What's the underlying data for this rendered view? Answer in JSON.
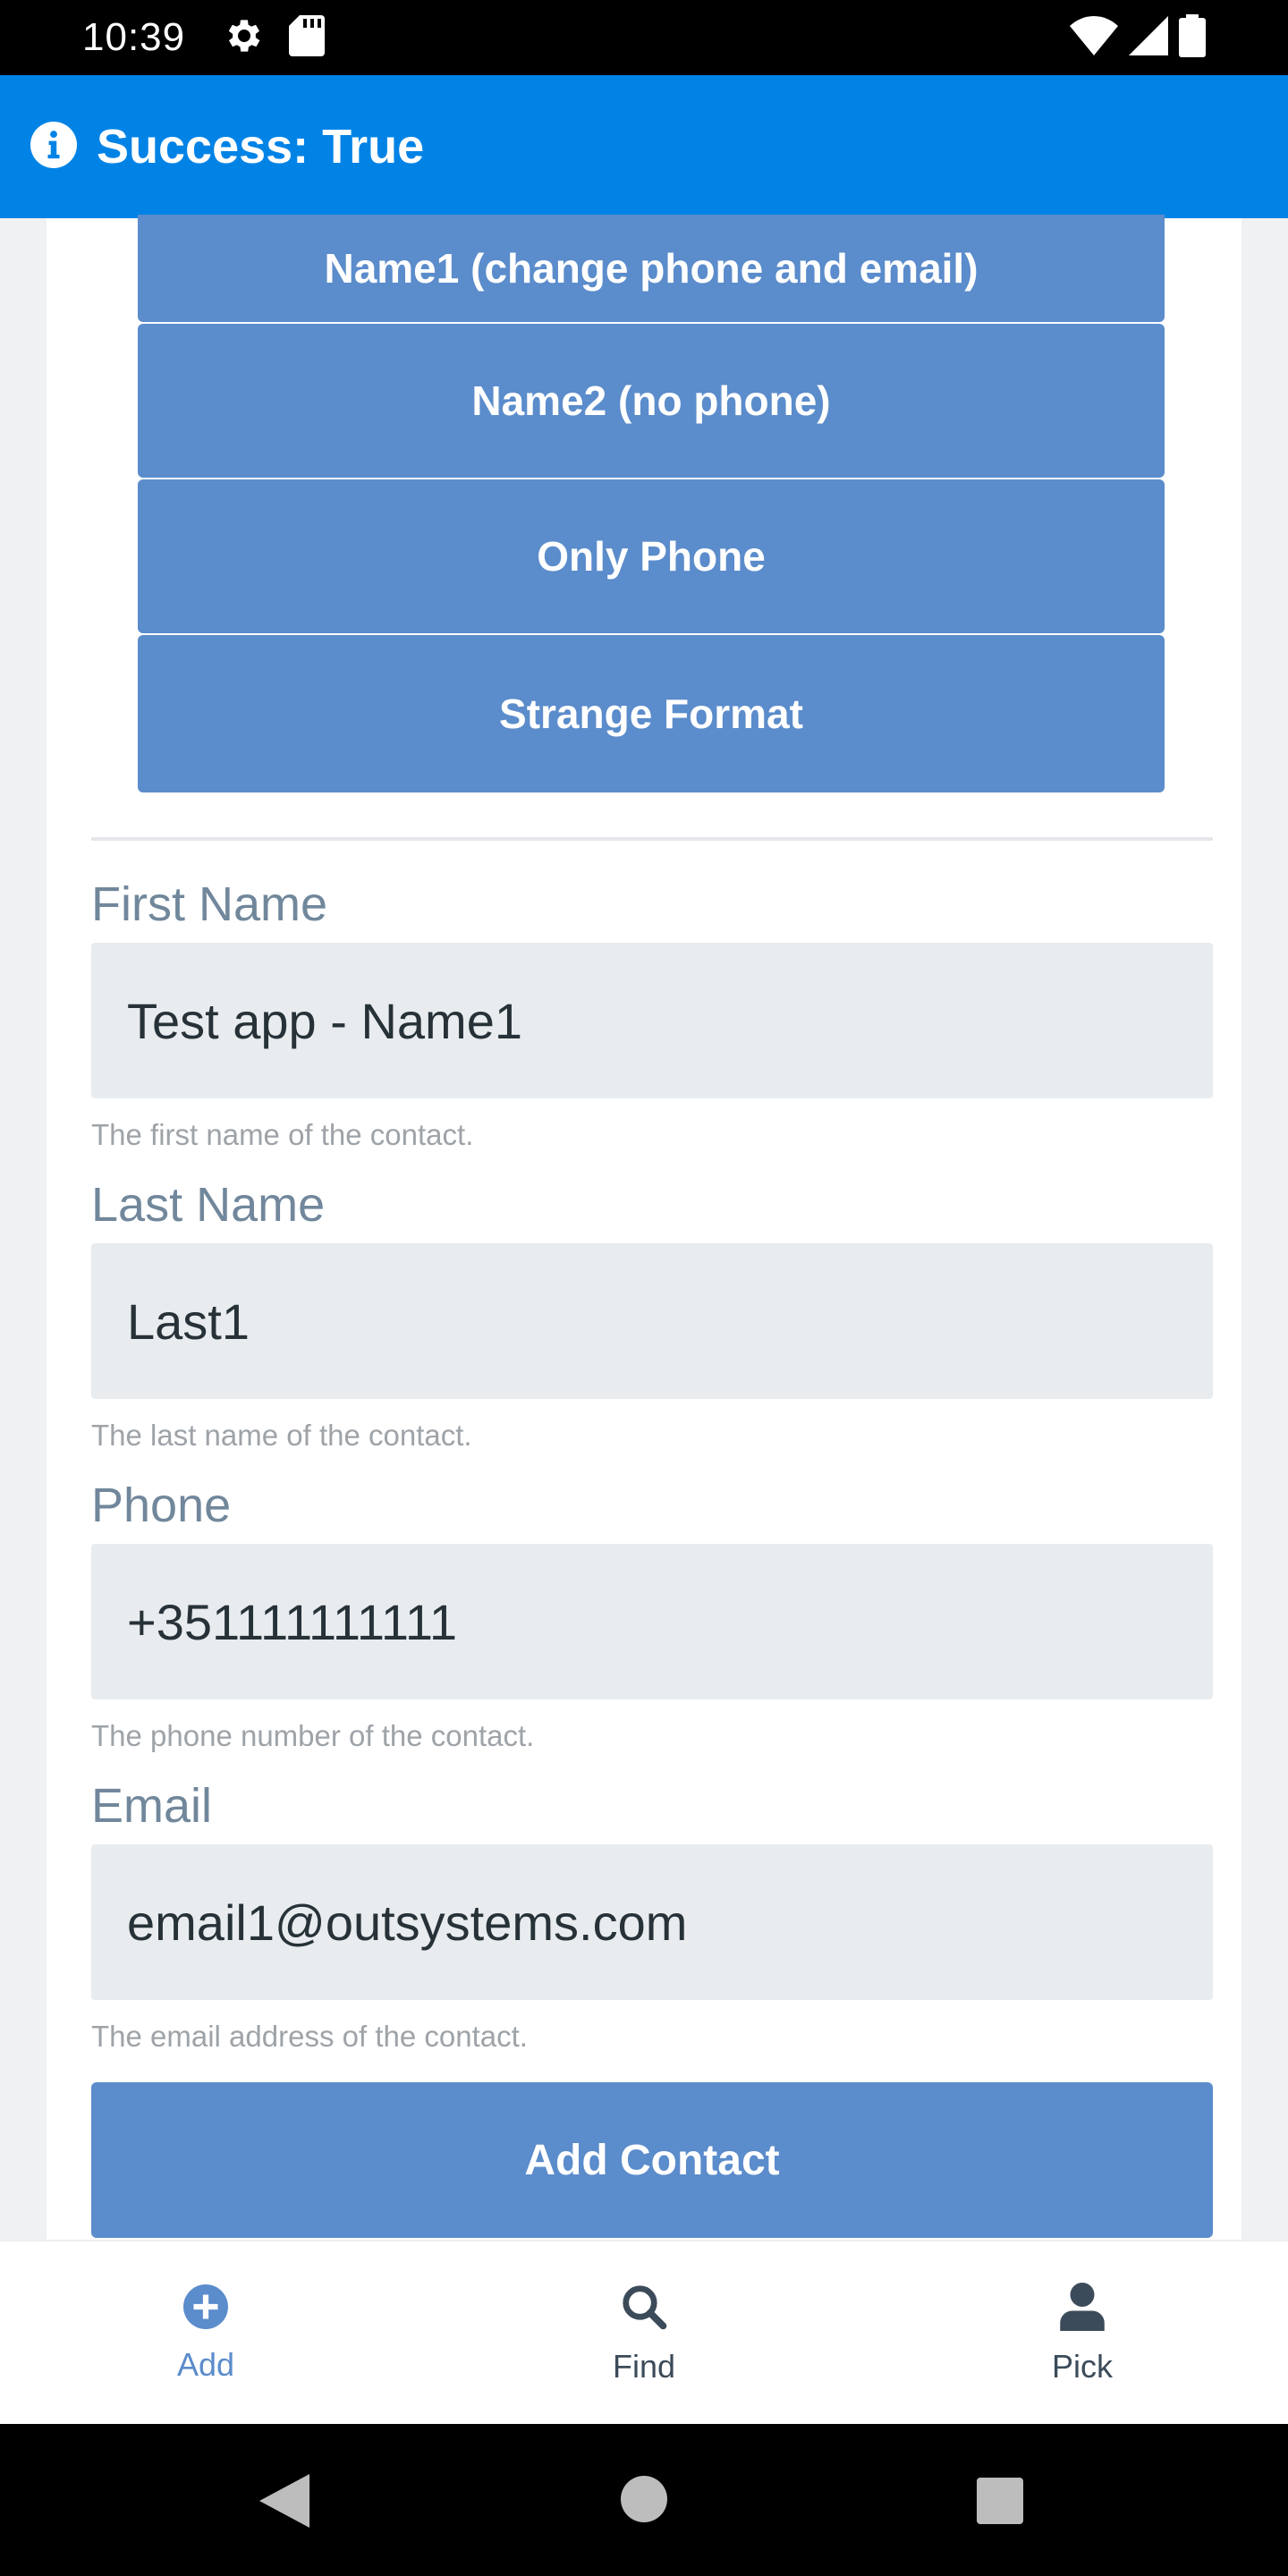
{
  "status_bar": {
    "time": "10:39"
  },
  "toast": {
    "message": "Success: True"
  },
  "presets": [
    {
      "label": "Name1 (change phone and email)"
    },
    {
      "label": "Name2 (no phone)"
    },
    {
      "label": "Only Phone"
    },
    {
      "label": "Strange Format"
    }
  ],
  "form": {
    "first_name": {
      "label": "First Name",
      "value": "Test app - Name1",
      "hint": "The first name of the contact."
    },
    "last_name": {
      "label": "Last Name",
      "value": "Last1",
      "hint": "The last name of the contact."
    },
    "phone": {
      "label": "Phone",
      "value": "+351111111111",
      "hint": "The phone number of the contact."
    },
    "email": {
      "label": "Email",
      "value": "email1@outsystems.com",
      "hint": "The email address of the contact."
    },
    "submit_label": "Add Contact"
  },
  "bottom_nav": [
    {
      "label": "Add",
      "icon": "plus-circle-icon",
      "active": true
    },
    {
      "label": "Find",
      "icon": "search-icon",
      "active": false
    },
    {
      "label": "Pick",
      "icon": "person-icon",
      "active": false
    }
  ],
  "colors": {
    "toast": "#0183e6",
    "button": "#5b8ccb",
    "nav_active": "#5b8ccb",
    "nav_inactive": "#3c4b59"
  }
}
